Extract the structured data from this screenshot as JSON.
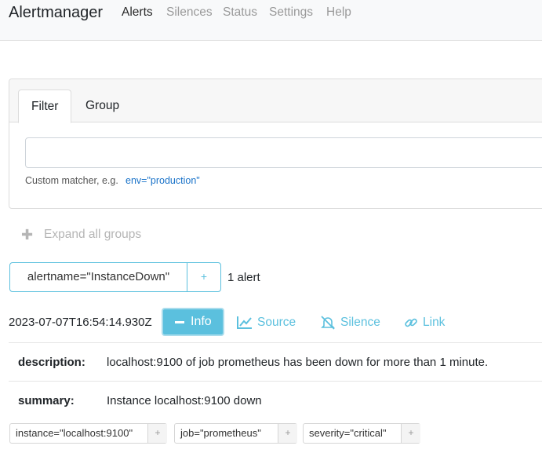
{
  "navbar": {
    "brand": "Alertmanager",
    "links": [
      "Alerts",
      "Silences",
      "Status",
      "Settings",
      "Help"
    ]
  },
  "filter": {
    "tabs": [
      "Filter",
      "Group"
    ],
    "input_value": "",
    "hint": "Custom matcher, e.g.",
    "example": "env=\"production\""
  },
  "expand_all": {
    "icon": "plus-icon",
    "label": "Expand all groups"
  },
  "group": {
    "matcher": "alertname=\"InstanceDown\"",
    "add_symbol": "+",
    "count": "1 alert"
  },
  "alert": {
    "timestamp": "2023-07-07T16:54:14.930Z",
    "info_label": "Info",
    "source_label": "Source",
    "silence_label": "Silence",
    "link_label": "Link",
    "annotations": [
      {
        "key": "description:",
        "value": "localhost:9100 of job prometheus has been down for more than 1 minute."
      },
      {
        "key": "summary:",
        "value": "Instance localhost:9100 down"
      }
    ],
    "labels": [
      {
        "text": "instance=\"localhost:9100\"",
        "plus": "+"
      },
      {
        "text": "job=\"prometheus\"",
        "plus": "+"
      },
      {
        "text": "severity=\"critical\"",
        "plus": "+"
      }
    ]
  },
  "colors": {
    "accent": "#5bc0de",
    "link": "#1a73c9"
  }
}
